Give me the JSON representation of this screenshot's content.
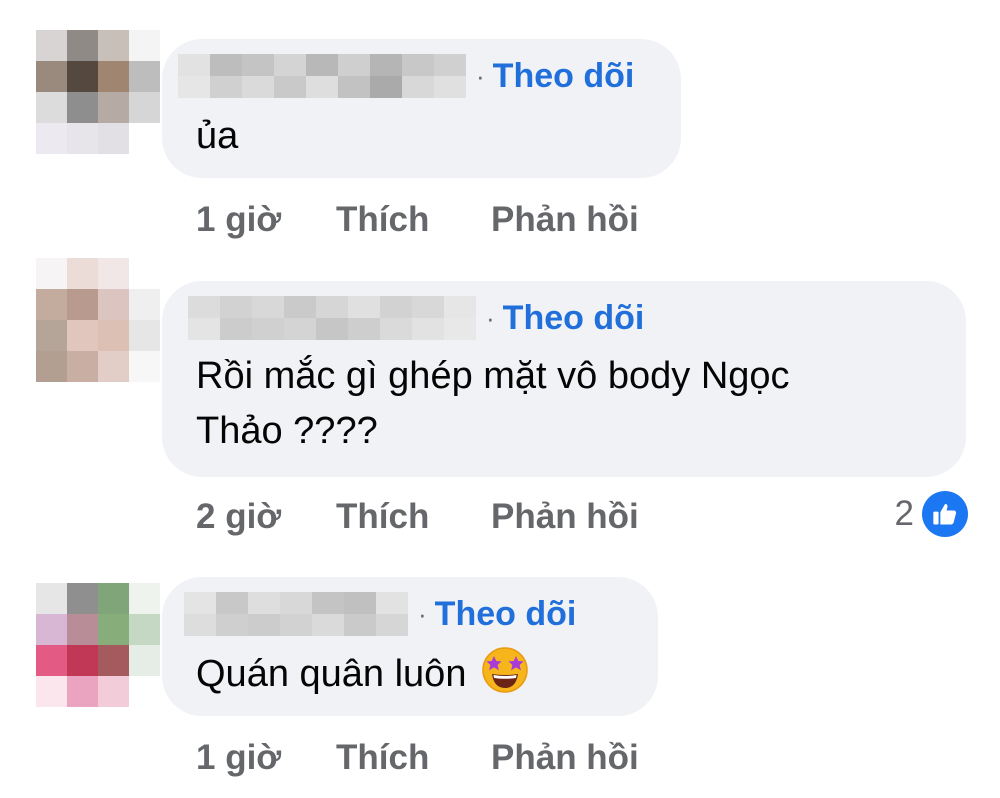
{
  "follow_separator": "·",
  "comments": [
    {
      "follow_label": "Theo dõi",
      "text": "ủa",
      "time": "1 giờ",
      "like_label": "Thích",
      "reply_label": "Phản hồi"
    },
    {
      "follow_label": "Theo dõi",
      "text_line1": "Rồi mắc gì ghép mặt vô body Ngọc",
      "text_line2": "Thảo ????",
      "time": "2 giờ",
      "like_label": "Thích",
      "reply_label": "Phản hồi",
      "reaction_count": "2",
      "reaction_icon": "like-thumbs-up"
    },
    {
      "follow_label": "Theo dõi",
      "text": "Quán quân luôn",
      "emoji": "star-struck",
      "time": "1 giờ",
      "like_label": "Thích",
      "reply_label": "Phản hồi"
    }
  ],
  "colors": {
    "bubble": "#f0f2f5",
    "follow": "#216fdb",
    "meta": "#65676b",
    "like_badge": "#1b77f2"
  }
}
